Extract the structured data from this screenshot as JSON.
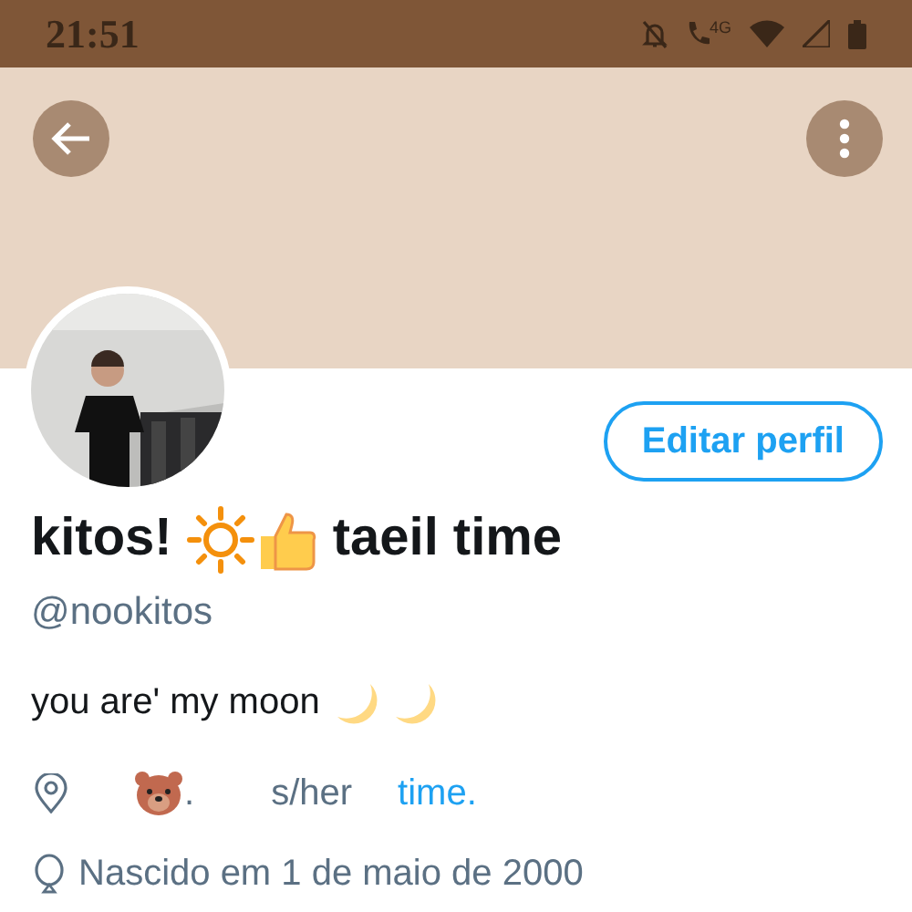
{
  "status_bar": {
    "time": "21:51",
    "network": "4G"
  },
  "profile": {
    "edit_button": "Editar perfil",
    "display_name_parts": [
      "kitos!",
      "taeil time"
    ],
    "handle": "@nookitos",
    "bio": "you are' my moon",
    "location": ".",
    "pronouns": "s/her",
    "link": "time.",
    "birthday": "Nascido em 1 de maio de 2000"
  }
}
